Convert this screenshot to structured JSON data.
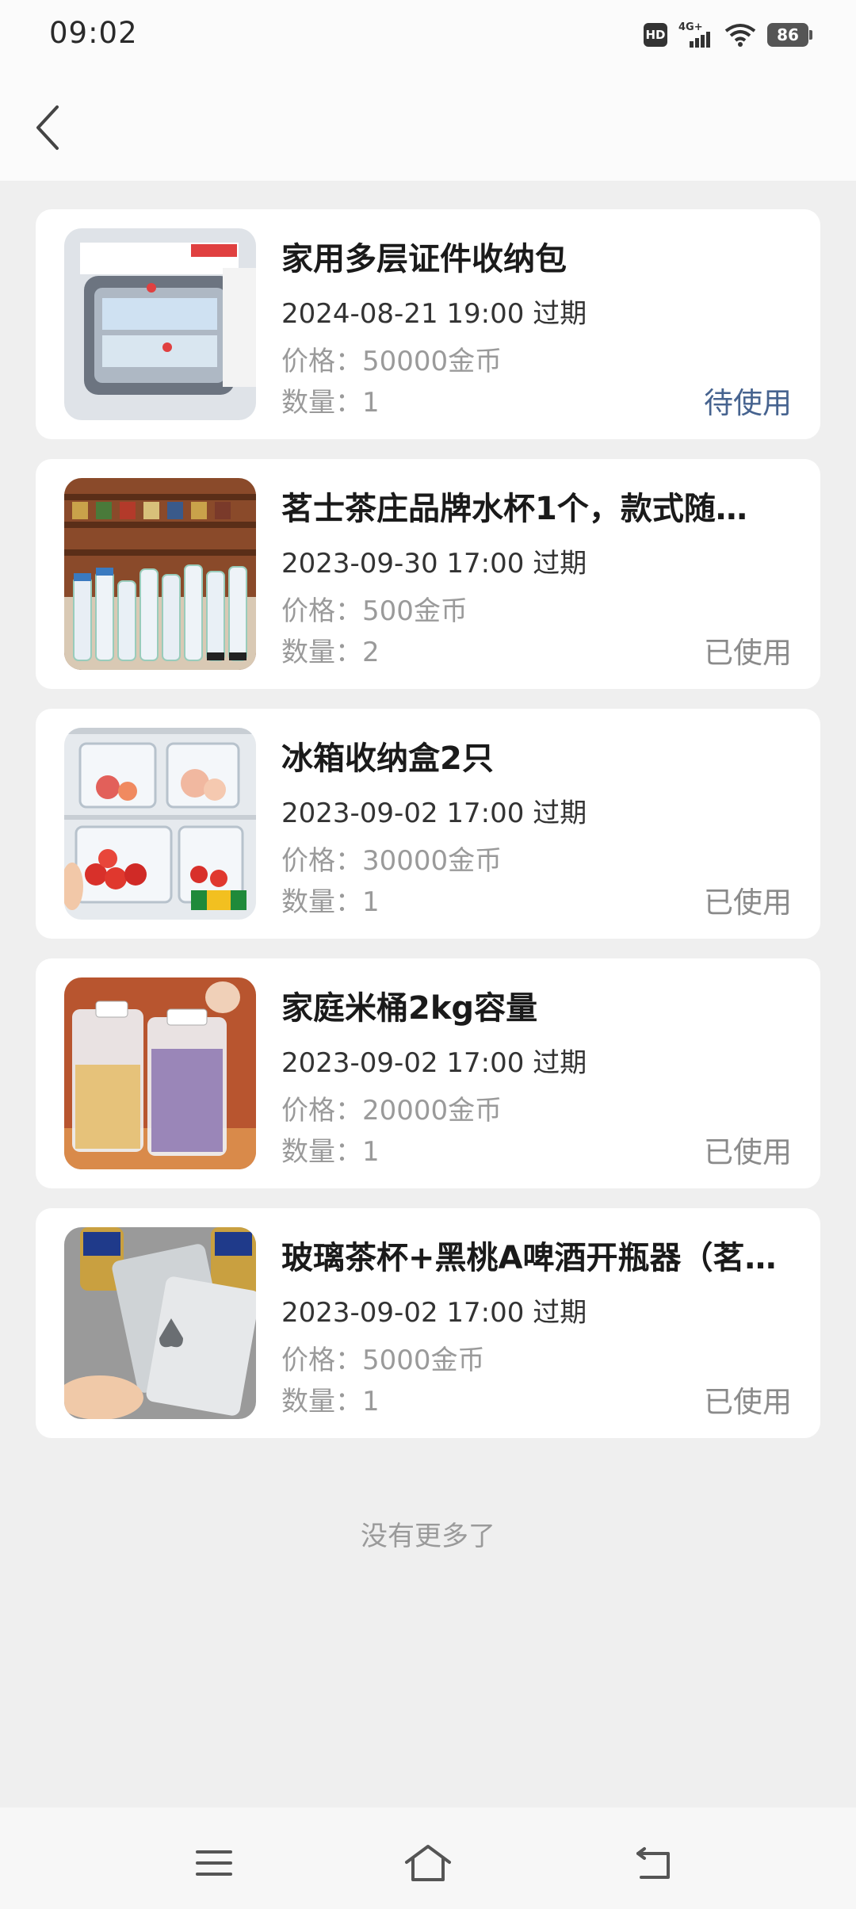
{
  "status_bar": {
    "time": "09:02",
    "hd": "HD",
    "network": "4G+",
    "battery": "86"
  },
  "items": [
    {
      "title": "家用多层证件收纳包",
      "expire": "2024-08-21 19:00 过期",
      "price": "价格：50000金币",
      "quantity": "数量：1",
      "status": "待使用",
      "image_icon": "document-bag-image"
    },
    {
      "title": "茗士茶庄品牌水杯1个，款式随…",
      "expire": "2023-09-30 17:00 过期",
      "price": "价格：500金币",
      "quantity": "数量：2",
      "status": "已使用",
      "image_icon": "water-bottles-image"
    },
    {
      "title": "冰箱收纳盒2只",
      "expire": "2023-09-02 17:00 过期",
      "price": "价格：30000金币",
      "quantity": "数量：1",
      "status": "已使用",
      "image_icon": "fridge-box-image"
    },
    {
      "title": "家庭米桶2kg容量",
      "expire": "2023-09-02 17:00 过期",
      "price": "价格：20000金币",
      "quantity": "数量：1",
      "status": "已使用",
      "image_icon": "rice-bucket-image"
    },
    {
      "title": "玻璃茶杯+黑桃A啤酒开瓶器（茗…",
      "expire": "2023-09-02 17:00 过期",
      "price": "价格：5000金币",
      "quantity": "数量：1",
      "status": "已使用",
      "image_icon": "bottle-opener-image"
    }
  ],
  "footer": {
    "no_more": "没有更多了"
  },
  "colors": {
    "pending_status": "#46638f",
    "used_status": "#8a8a8a"
  }
}
